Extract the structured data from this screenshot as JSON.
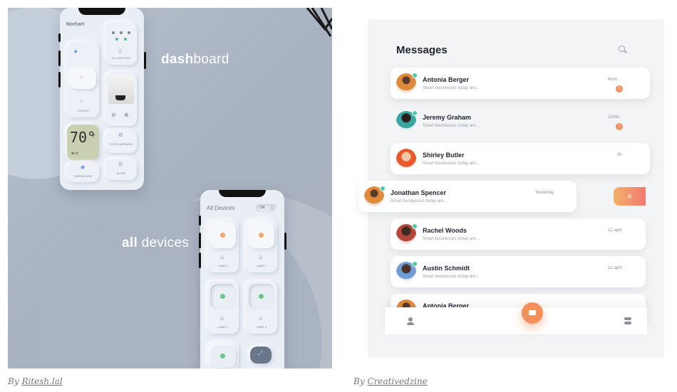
{
  "left": {
    "dashboard_bold": "dash",
    "dashboard_rest": "board",
    "alldevices_bold": "all",
    "alldevices_rest": "devices",
    "phone1": {
      "title": "Norhart",
      "tiles": {
        "all_devices": "ALL DEVICES",
        "locked": "LOCKED",
        "thermostat": "THERMOSTAT",
        "good_morning": "GOOD MORNING",
        "more": "MORE"
      },
      "temperature": "70°",
      "temp_unit": "F"
    },
    "phone2": {
      "title": "All Devices",
      "toggle": "ON",
      "lamps": [
        "LAMP 1",
        "LAMP 2",
        "LAMP 3",
        "LAMP 4"
      ]
    },
    "caption_prefix": "By",
    "caption_author": "Ritesh.lal"
  },
  "right": {
    "title": "Messages",
    "messages": [
      {
        "name": "Antonia Berger",
        "preview": "Smart businesses today are...",
        "time": "4min",
        "badge": "1"
      },
      {
        "name": "Jeremy Graham",
        "preview": "Smart businesses today are...",
        "time": "12min",
        "badge": "1"
      },
      {
        "name": "Shirley Butler",
        "preview": "Smart businesses today are...",
        "time": "3h",
        "badge": ""
      },
      {
        "name": "Jonathan Spencer",
        "preview": "Smart businesses today are...",
        "time": "Yesterday",
        "badge": ""
      },
      {
        "name": "Rachel Woods",
        "preview": "Smart businesses today are...",
        "time": "12 april",
        "badge": ""
      },
      {
        "name": "Austin Schmidt",
        "preview": "Smart businesses today are...",
        "time": "12 april",
        "badge": ""
      },
      {
        "name": "Antonia Berger",
        "preview": "",
        "time": "",
        "badge": ""
      }
    ],
    "delete_glyph": "×",
    "caption_prefix": "By",
    "caption_author": "Creativedzine",
    "colors": {
      "accent": "#f3905b",
      "online": "#4cc9a4"
    }
  }
}
